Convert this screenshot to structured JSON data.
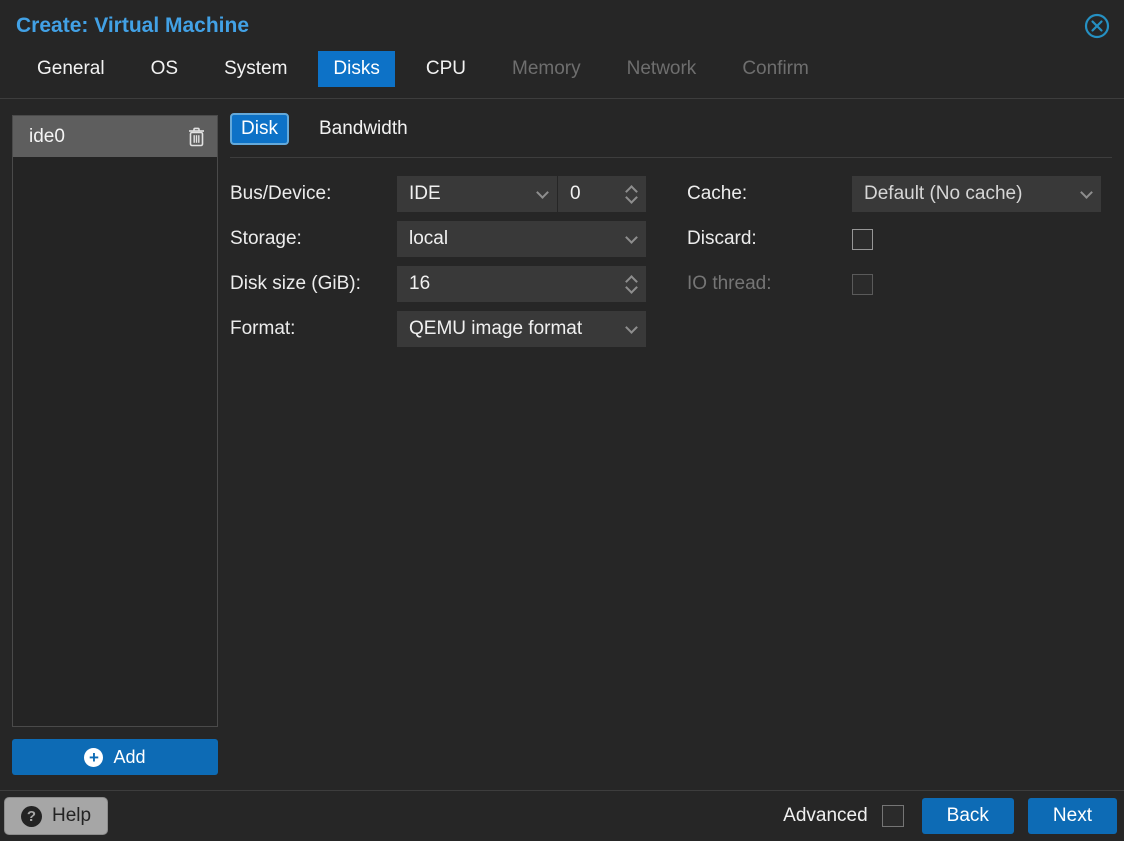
{
  "window": {
    "title": "Create: Virtual Machine"
  },
  "tabs": [
    {
      "label": "General",
      "state": "normal"
    },
    {
      "label": "OS",
      "state": "normal"
    },
    {
      "label": "System",
      "state": "normal"
    },
    {
      "label": "Disks",
      "state": "active"
    },
    {
      "label": "CPU",
      "state": "normal"
    },
    {
      "label": "Memory",
      "state": "disabled"
    },
    {
      "label": "Network",
      "state": "disabled"
    },
    {
      "label": "Confirm",
      "state": "disabled"
    }
  ],
  "left_panel": {
    "selected_item": "ide0",
    "add_label": "Add",
    "plus_glyph": "+"
  },
  "subtabs": [
    {
      "label": "Disk",
      "active": true
    },
    {
      "label": "Bandwidth",
      "active": false
    }
  ],
  "form": {
    "bus_device": {
      "label": "Bus/Device:",
      "select_value": "IDE",
      "spinner_value": "0"
    },
    "storage": {
      "label": "Storage:",
      "value": "local"
    },
    "disk_size": {
      "label": "Disk size (GiB):",
      "value": "16"
    },
    "format": {
      "label": "Format:",
      "value": "QEMU image format"
    },
    "cache": {
      "label": "Cache:",
      "value": "Default (No cache)"
    },
    "discard": {
      "label": "Discard:",
      "checked": false
    },
    "io_thread": {
      "label": "IO thread:",
      "checked": false,
      "disabled": true
    }
  },
  "footer": {
    "help_label": "Help",
    "help_glyph": "?",
    "advanced_label": "Advanced",
    "advanced_checked": false,
    "back_label": "Back",
    "next_label": "Next"
  },
  "colors": {
    "accent_blue": "#0d72c7",
    "button_blue": "#0d6bb5",
    "title_blue": "#42a1e5",
    "close_teal": "#2590c2",
    "background": "#262626",
    "field_bg": "#393939",
    "selected_row": "#5e5e5e"
  }
}
